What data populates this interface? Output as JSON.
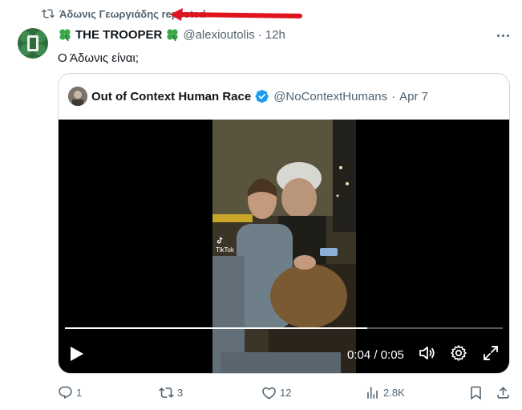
{
  "repost": {
    "text": "Άδωνις Γεωργιάδης reposted"
  },
  "tweet": {
    "display_name": "THE TROOPER",
    "handle": "@alexioutolis",
    "separator": "·",
    "time": "12h",
    "text": "Ο Άδωνις είναι;"
  },
  "quote": {
    "display_name": "Out of Context Human Race",
    "handle": "@NoContextHumans",
    "separator": "·",
    "date": "Apr 7"
  },
  "video": {
    "timecode": "0:04 / 0:05",
    "progress": 0.69,
    "tiktok_label": "TikTok"
  },
  "actions": {
    "replies": "1",
    "reposts": "3",
    "likes": "12",
    "views": "2.8K"
  },
  "colors": {
    "secondary_text": "#536471",
    "verified": "#1d9bf0",
    "annotation_arrow": "#e0141e"
  }
}
